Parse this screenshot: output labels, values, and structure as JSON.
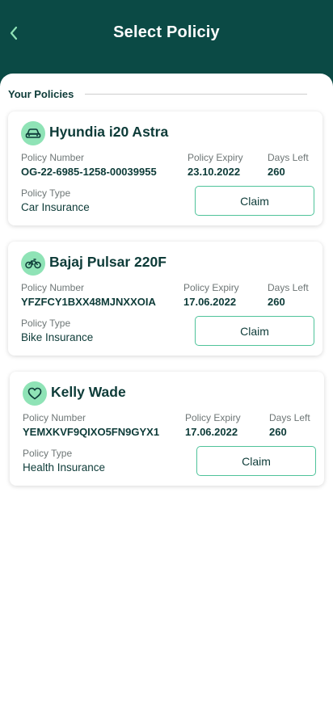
{
  "header": {
    "title": "Select Policiy",
    "back_icon": "chevron-left-icon"
  },
  "section": {
    "title": "Your Policies"
  },
  "labels": {
    "policy_number": "Policy Number",
    "policy_expiry": "Policy Expiry",
    "days_left": "Days Left",
    "policy_type": "Policy Type",
    "claim": "Claim"
  },
  "policies": [
    {
      "icon": "car-icon",
      "name": "Hyundia i20 Astra",
      "policy_number": "OG-22-6985-1258-00039955",
      "policy_expiry": "23.10.2022",
      "days_left": "260",
      "policy_type": "Car Insurance"
    },
    {
      "icon": "bike-icon",
      "name": "Bajaj Pulsar 220F",
      "policy_number": "YFZFCY1BXX48MJNXXOIA",
      "policy_expiry": "17.06.2022",
      "days_left": "260",
      "policy_type": "Bike Insurance"
    },
    {
      "icon": "heart-icon",
      "name": "Kelly Wade",
      "policy_number": "YEMXKVF9QIXO5FN9GYX1",
      "policy_expiry": "17.06.2022",
      "days_left": "260",
      "policy_type": "Health Insurance"
    }
  ],
  "colors": {
    "header_bg": "#0b4a45",
    "accent": "#8fe3b6",
    "button_border": "#4fc39a",
    "text_dark": "#0d3b38"
  }
}
